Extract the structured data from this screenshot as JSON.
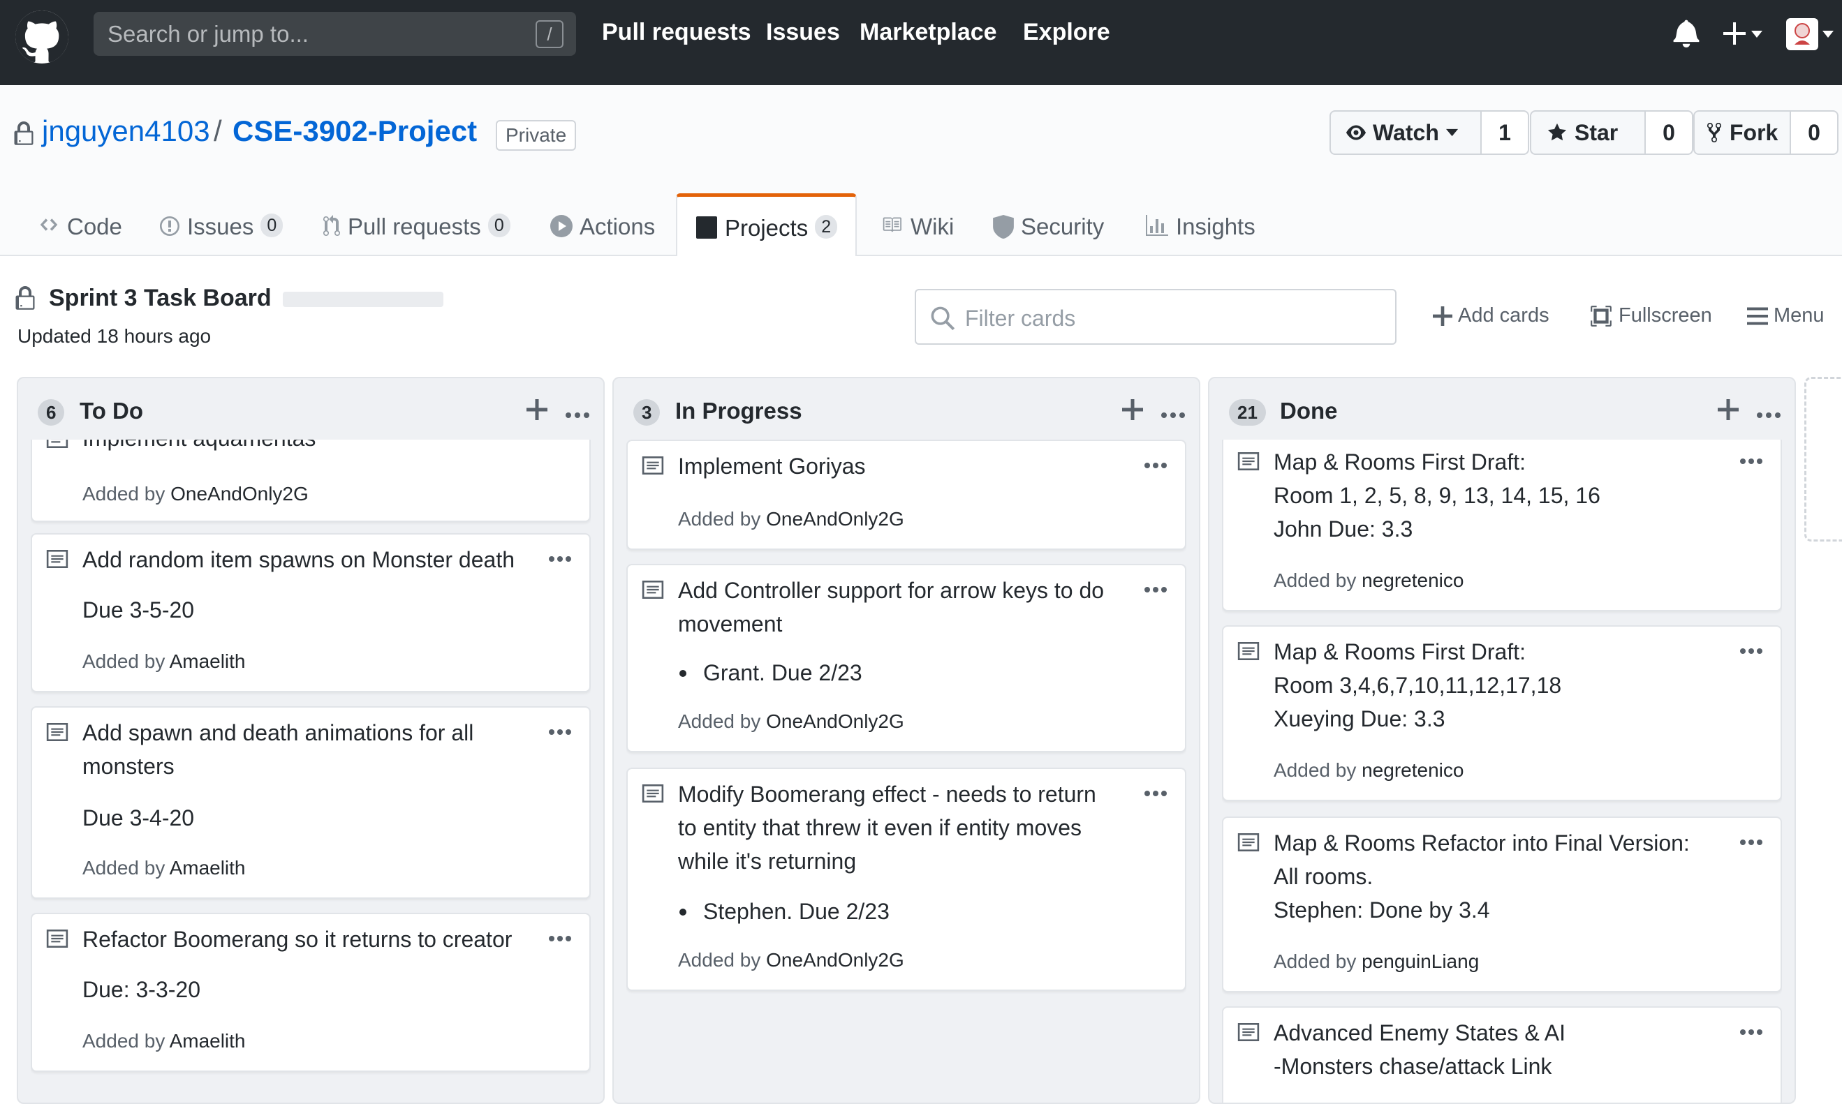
{
  "header": {
    "search_placeholder": "Search or jump to...",
    "search_key": "/",
    "nav": [
      "Pull requests",
      "Issues",
      "Marketplace",
      "Explore"
    ]
  },
  "repo": {
    "owner": "jnguyen4103",
    "separator": "/",
    "name": "CSE-3902-Project",
    "visibility": "Private",
    "watch": {
      "label": "Watch",
      "count": "1"
    },
    "star": {
      "label": "Star",
      "count": "0"
    },
    "fork": {
      "label": "Fork",
      "count": "0"
    }
  },
  "tabs": [
    {
      "label": "Code",
      "icon": "code-icon"
    },
    {
      "label": "Issues",
      "count": "0",
      "icon": "issue-icon"
    },
    {
      "label": "Pull requests",
      "count": "0",
      "icon": "pull-request-icon"
    },
    {
      "label": "Actions",
      "icon": "play-icon"
    },
    {
      "label": "Projects",
      "count": "2",
      "icon": "project-icon",
      "selected": true
    },
    {
      "label": "Wiki",
      "icon": "book-icon"
    },
    {
      "label": "Security",
      "icon": "shield-icon"
    },
    {
      "label": "Insights",
      "icon": "graph-icon"
    }
  ],
  "project": {
    "title": "Sprint 3 Task Board",
    "updated": "Updated 18 hours ago",
    "filter_placeholder": "Filter cards",
    "actions": [
      "Add cards",
      "Fullscreen",
      "Menu"
    ]
  },
  "columns": [
    {
      "name": "To Do",
      "count": "6",
      "cards": [
        {
          "title": "Implement aquamentas",
          "added_prefix": "Added by ",
          "added_by": "OneAndOnly2G"
        },
        {
          "title": "Add random item spawns on Monster death",
          "line": "Due 3-5-20",
          "added_prefix": "Added by ",
          "added_by": "Amaelith"
        },
        {
          "title": "Add spawn and death animations for all\nmonsters",
          "line": "Due 3-4-20",
          "added_prefix": "Added by ",
          "added_by": "Amaelith"
        },
        {
          "title": "Refactor Boomerang so it returns to creator",
          "line": "Due: 3-3-20",
          "added_prefix": "Added by ",
          "added_by": "Amaelith"
        }
      ]
    },
    {
      "name": "In Progress",
      "count": "3",
      "cards": [
        {
          "title": "Implement Goriyas",
          "added_prefix": "Added by ",
          "added_by": "OneAndOnly2G"
        },
        {
          "title": "Add Controller support for arrow keys to do\nmovement",
          "bullet": "Grant. Due 2/23",
          "added_prefix": "Added by ",
          "added_by": "OneAndOnly2G"
        },
        {
          "title": "Modify Boomerang effect - needs to return\nto entity that threw it even if entity moves\nwhile it's returning",
          "bullet": "Stephen. Due 2/23",
          "added_prefix": "Added by ",
          "added_by": "OneAndOnly2G"
        }
      ]
    },
    {
      "name": "Done",
      "count": "21",
      "cards": [
        {
          "title": "Map & Rooms First Draft:\nRoom 1, 2, 5, 8, 9, 13, 14, 15, 16\nJohn Due: 3.3",
          "added_prefix": "Added by ",
          "added_by": "negretenico"
        },
        {
          "title": "Map & Rooms First Draft:\nRoom 3,4,6,7,10,11,12,17,18\nXueying Due: 3.3",
          "added_prefix": "Added by ",
          "added_by": "negretenico"
        },
        {
          "title": "Map & Rooms Refactor into Final Version:\nAll rooms.\nStephen: Done by 3.4",
          "added_prefix": "Added by ",
          "added_by": "penguinLiang"
        },
        {
          "title": "Advanced Enemy States & AI\n-Monsters chase/attack Link"
        }
      ]
    }
  ],
  "colors": {
    "header_bg": "#24292e",
    "link": "#0366d6",
    "tab_accent": "#e36209",
    "column_bg": "#eff1f4"
  }
}
